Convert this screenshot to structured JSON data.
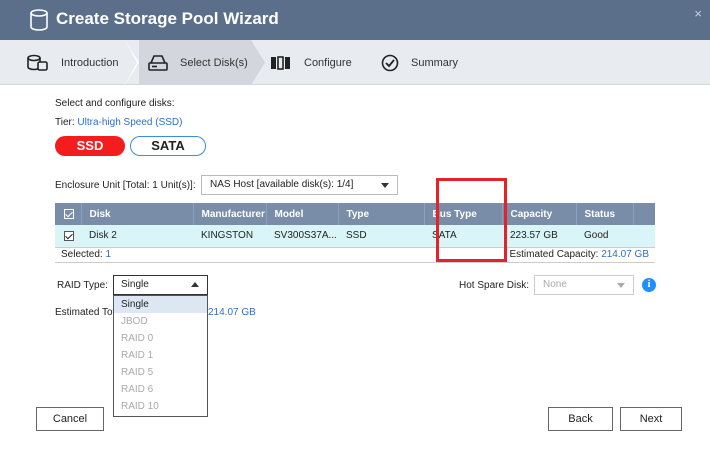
{
  "window": {
    "title": "Create Storage Pool Wizard",
    "close_glyph": "×"
  },
  "steps": [
    {
      "label": "Introduction",
      "icon": "database-icon"
    },
    {
      "label": "Select Disk(s)",
      "icon": "disk-drive-icon"
    },
    {
      "label": "Configure",
      "icon": "configure-icon"
    },
    {
      "label": "Summary",
      "icon": "checkmark-circle-icon"
    }
  ],
  "intro": {
    "heading": "Select and configure disks:",
    "tier_label": "Tier:",
    "tier_value": "Ultra-high Speed (SSD)"
  },
  "tier_buttons": {
    "ssd": "SSD",
    "sata": "SATA"
  },
  "enclosure": {
    "label": "Enclosure Unit [Total: 1 Unit(s)]:",
    "selected": "NAS Host [available disk(s): 1/4]"
  },
  "table": {
    "headers": [
      "Disk",
      "Manufacturer",
      "Model",
      "Type",
      "Bus Type",
      "Capacity",
      "Status"
    ],
    "rows": [
      {
        "disk": "Disk 2",
        "manufacturer": "KINGSTON",
        "model": "SV300S37A...",
        "type": "SSD",
        "bus_type": "SATA",
        "capacity": "223.57 GB",
        "status": "Good"
      }
    ],
    "selected_label": "Selected:",
    "selected_count": "1",
    "est_capacity_label": "Estimated Capacity:",
    "est_capacity_value": "214.07 GB"
  },
  "raid": {
    "label": "RAID Type:",
    "selected": "Single",
    "options": [
      "Single",
      "JBOD",
      "RAID 0",
      "RAID 1",
      "RAID 5",
      "RAID 6",
      "RAID 10"
    ]
  },
  "hot_spare": {
    "label": "Hot Spare Disk:",
    "selected": "None"
  },
  "estimated_total": {
    "label_visible": "Estimated Tot",
    "value": "214.07 GB"
  },
  "buttons": {
    "cancel": "Cancel",
    "back": "Back",
    "next": "Next"
  },
  "colors": {
    "titlebar": "#5c6f8a",
    "ssd": "#f31d1d",
    "accent": "#2f6fc4",
    "highlight_box": "#e2232a"
  }
}
